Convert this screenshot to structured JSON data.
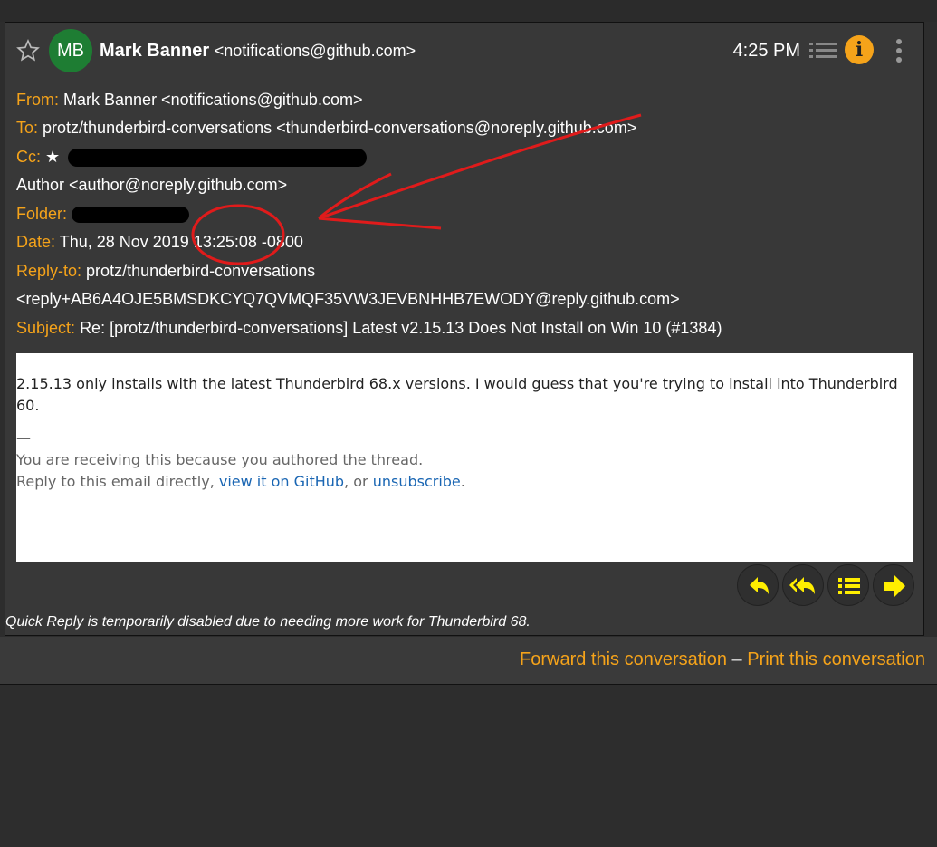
{
  "header": {
    "avatar_initials": "MB",
    "sender_name": "Mark Banner",
    "sender_email": "<notifications@github.com>",
    "time": "4:25 PM"
  },
  "details": {
    "from_label": "From:",
    "from_value": "Mark Banner <notifications@github.com>",
    "to_label": "To:",
    "to_value": "protz/thunderbird-conversations <thunderbird-conversations@noreply.github.com>",
    "cc_label": "Cc:",
    "cc_value": "★",
    "author_value": "Author <author@noreply.github.com>",
    "folder_label": "Folder:",
    "date_label": "Date:",
    "date_value": "Thu, 28 Nov 2019 13:25:08 -0800",
    "replyto_label": "Reply-to:",
    "replyto_value1": "protz/thunderbird-conversations",
    "replyto_value2": "<reply+AB6A4OJE5BMSDKCYQ7QVMQF35VW3JEVBNHHB7EWODY@reply.github.com>",
    "subject_label": "Subject:",
    "subject_value": "Re: [protz/thunderbird-conversations] Latest v2.15.13 Does Not Install on Win 10 (#1384)"
  },
  "body": {
    "text": "2.15.13 only installs with the latest Thunderbird 68.x versions. I would guess that you're trying to install into Thunderbird 60.",
    "separator": "—",
    "sig_line1": "You are receiving this because you authored the thread.",
    "sig_line2_prefix": "Reply to this email directly, ",
    "link_github": "view it on GitHub",
    "sig_line2_mid": ", or ",
    "link_unsubscribe": "unsubscribe",
    "sig_line2_suffix": "."
  },
  "quick_reply_notice": "Quick Reply is temporarily disabled due to needing more work for Thunderbird 68.",
  "footer": {
    "forward_link": "Forward this conversation",
    "separator": " – ",
    "print_link": "Print this conversation"
  },
  "colors": {
    "accent_orange": "#f5a31a",
    "button_yellow": "#ffee00",
    "annotation_red": "#e01b1b",
    "avatar_green": "#1e7d33"
  }
}
